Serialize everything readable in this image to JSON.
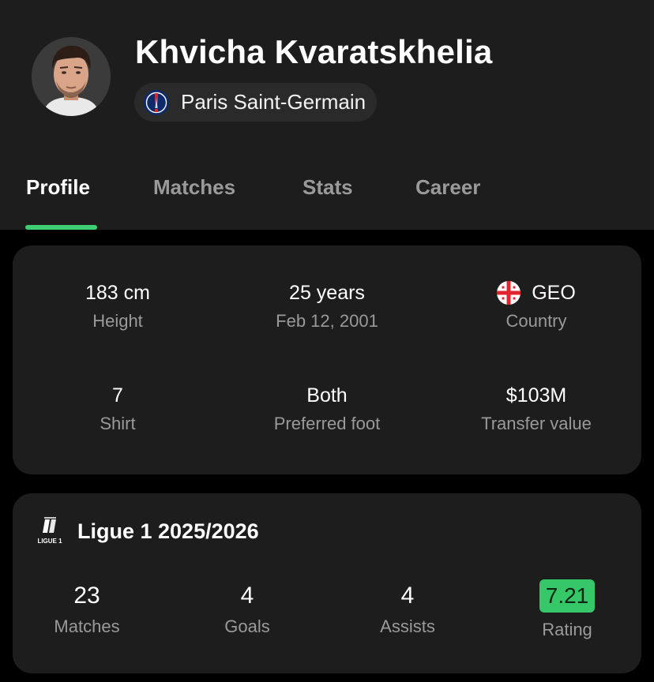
{
  "player": {
    "name": "Khvicha Kvaratskhelia",
    "team": "Paris Saint-Germain"
  },
  "tabs": [
    {
      "label": "Profile",
      "active": true
    },
    {
      "label": "Matches",
      "active": false
    },
    {
      "label": "Stats",
      "active": false
    },
    {
      "label": "Career",
      "active": false
    }
  ],
  "profile": {
    "height": {
      "value": "183 cm",
      "label": "Height"
    },
    "age": {
      "value": "25 years",
      "label": "Feb 12, 2001"
    },
    "country": {
      "value": "GEO",
      "label": "Country"
    },
    "shirt": {
      "value": "7",
      "label": "Shirt"
    },
    "foot": {
      "value": "Both",
      "label": "Preferred foot"
    },
    "transfer": {
      "value": "$103M",
      "label": "Transfer value"
    }
  },
  "league": {
    "title": "Ligue 1 2025/2026",
    "logo_text": "LIGUE 1",
    "stats": [
      {
        "value": "23",
        "label": "Matches"
      },
      {
        "value": "4",
        "label": "Goals"
      },
      {
        "value": "4",
        "label": "Assists"
      },
      {
        "value": "7.21",
        "label": "Rating"
      }
    ]
  },
  "colors": {
    "accent": "#3fce74",
    "rating_bg": "#36c768",
    "card_bg": "#1d1d1d",
    "page_bg": "#000000"
  },
  "icons": {
    "team_crest": "psg-crest-icon",
    "country_flag": "georgia-flag-icon",
    "league_logo": "ligue1-logo-icon"
  }
}
